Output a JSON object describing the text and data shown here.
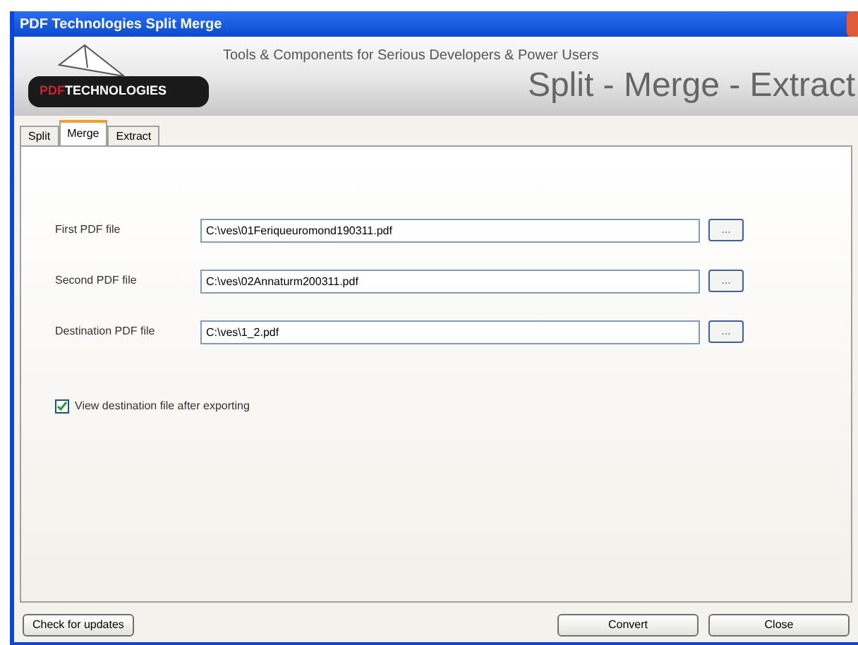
{
  "window": {
    "title": "PDF Technologies Split Merge"
  },
  "banner": {
    "logo_red": "PDF",
    "logo_white": "TECHNOLOGIES",
    "tagline": "Tools & Components for Serious Developers & Power Users",
    "heading": "Split - Merge - Extract"
  },
  "tabs": [
    {
      "label": "Split",
      "selected": false
    },
    {
      "label": "Merge",
      "selected": true
    },
    {
      "label": "Extract",
      "selected": false
    }
  ],
  "fields": [
    {
      "label": "First PDF file",
      "value": "C:\\ves\\01Feriqueuromond190311.pdf",
      "button": "..."
    },
    {
      "label": "Second PDF file",
      "value": "C:\\ves\\02Annaturm200311.pdf",
      "button": "..."
    },
    {
      "label": "Destination PDF file",
      "value": "C:\\ves\\1_2.pdf",
      "button": "..."
    }
  ],
  "option": {
    "label": "View destination file after exporting",
    "checked": true
  },
  "buttons": {
    "left": "Check for updates",
    "right": [
      "Convert",
      "Close"
    ]
  }
}
